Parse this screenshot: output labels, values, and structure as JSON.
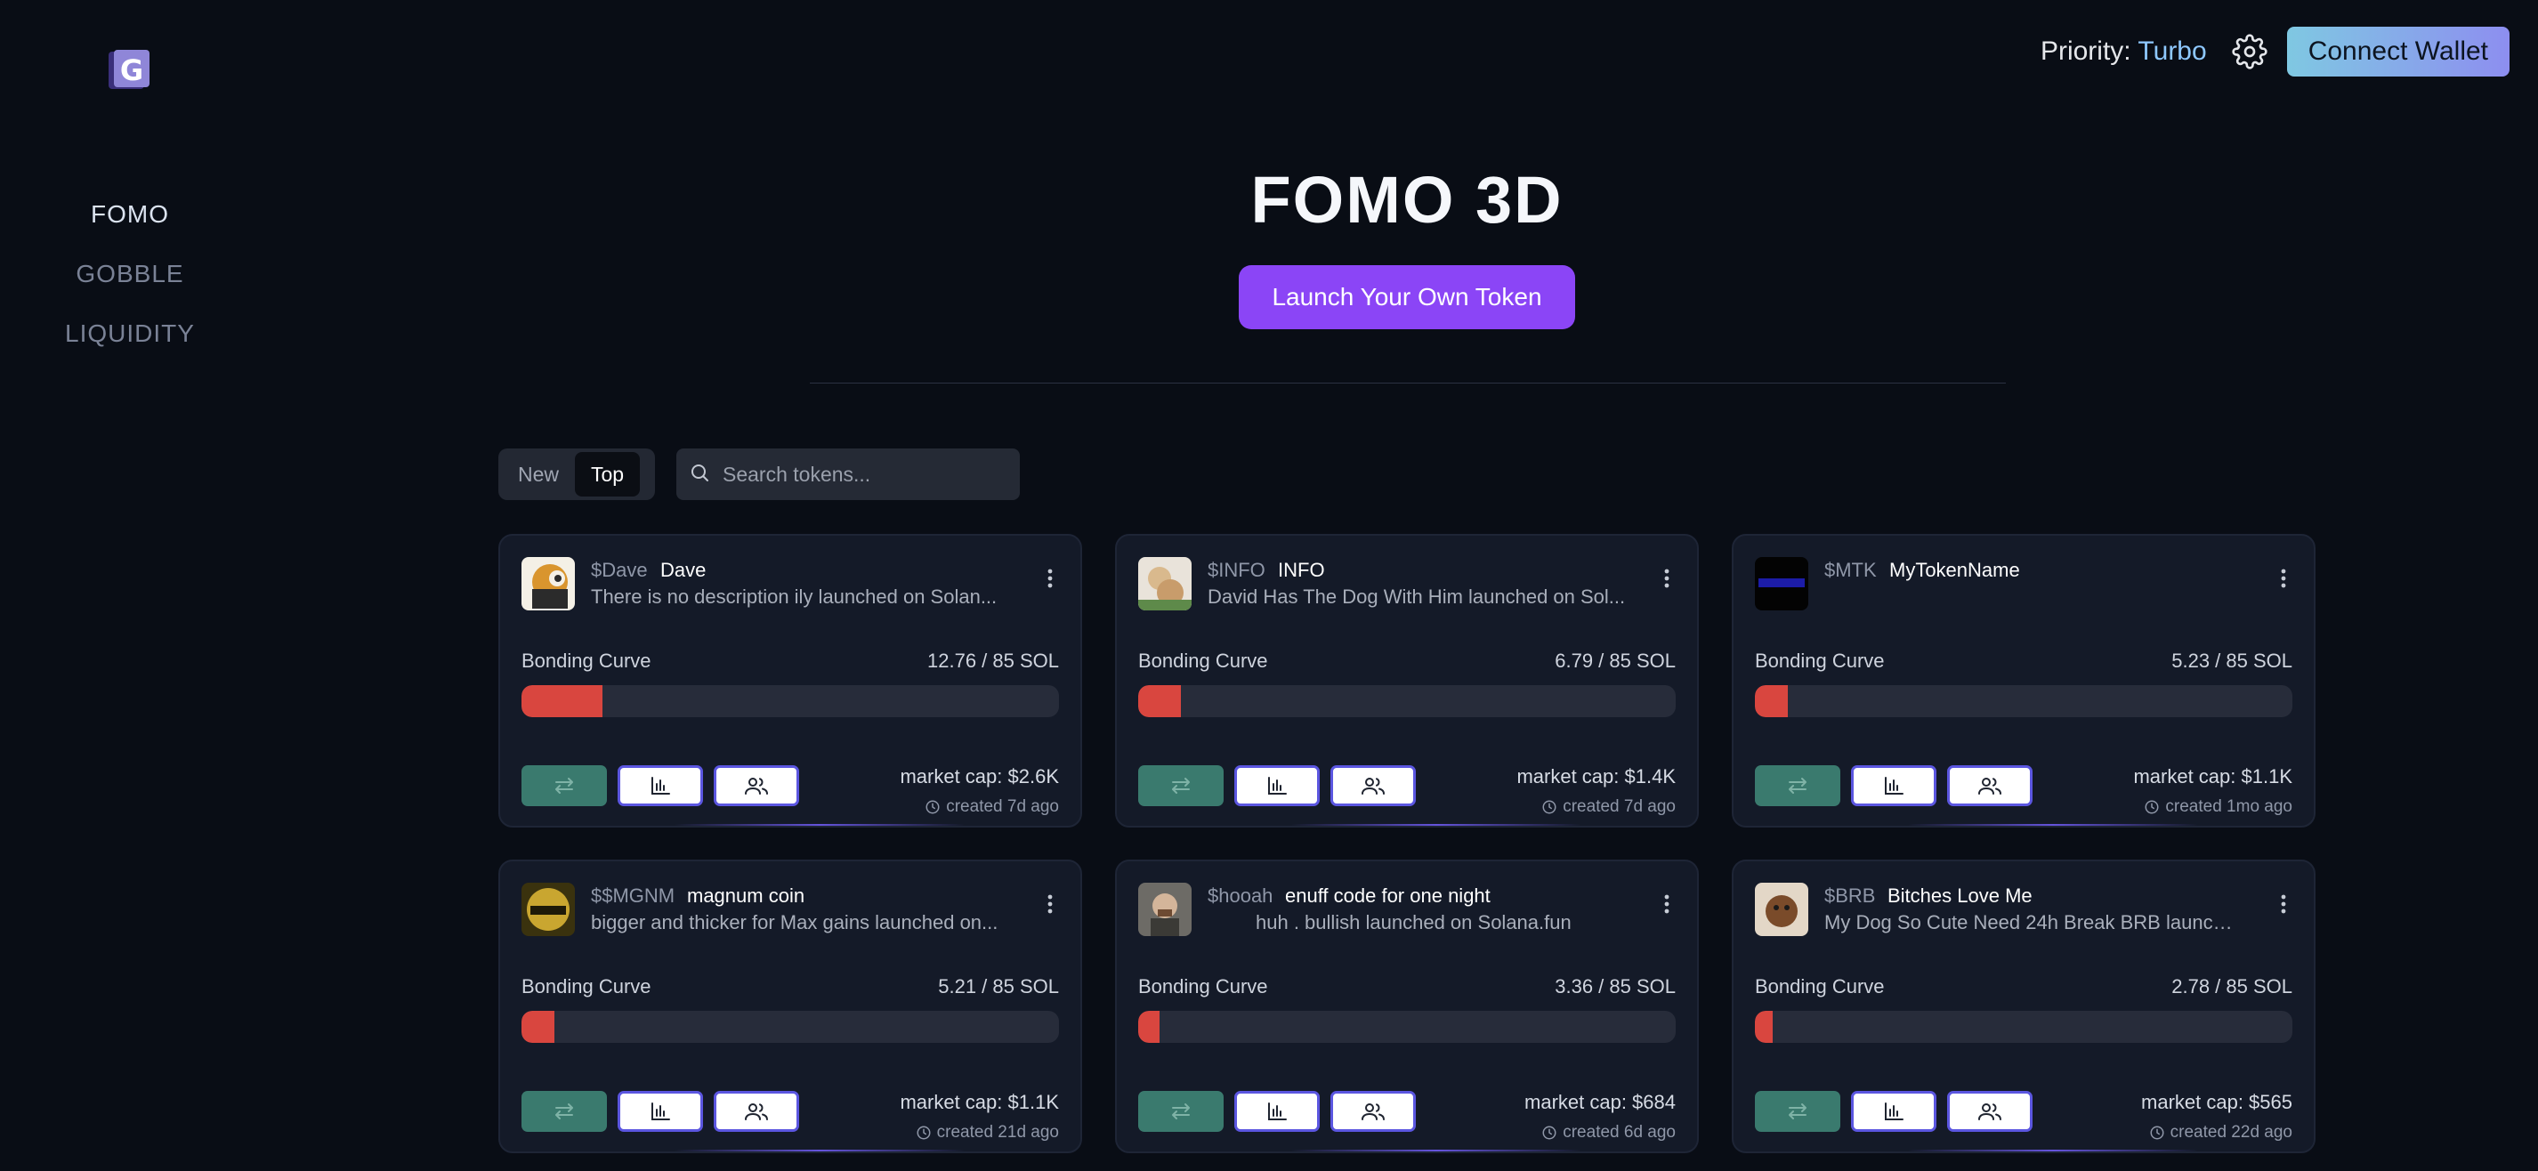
{
  "nav": {
    "items": [
      {
        "label": "FOMO",
        "active": true
      },
      {
        "label": "GOBBLE",
        "active": false
      },
      {
        "label": "LIQUIDITY",
        "active": false
      }
    ]
  },
  "topbar": {
    "priority_label": "Priority:",
    "priority_value": "Turbo",
    "connect_wallet": "Connect Wallet"
  },
  "hero": {
    "title": "FOMO 3D",
    "launch_button": "Launch Your Own Token"
  },
  "filters": {
    "new_label": "New",
    "top_label": "Top",
    "selected": "Top",
    "search_placeholder": "Search tokens..."
  },
  "colors": {
    "accent_purple": "#8b45f6",
    "progress_red": "#d9463f",
    "swap_green": "#3a7a6e",
    "background": "#090d15",
    "card": "#141a28"
  },
  "cards": [
    {
      "ticker": "$Dave",
      "name": "Dave",
      "description": "There is no description ily launched on Solan...",
      "bonding_label": "Bonding Curve",
      "bonding_value": "12.76 / 85 SOL",
      "progress": 0.15,
      "market_cap": "market cap: $2.6K",
      "created": "created 7d ago"
    },
    {
      "ticker": "$INFO",
      "name": "INFO",
      "description": "David Has The Dog With Him launched on Sol...",
      "bonding_label": "Bonding Curve",
      "bonding_value": "6.79 / 85 SOL",
      "progress": 0.08,
      "market_cap": "market cap: $1.4K",
      "created": "created 7d ago"
    },
    {
      "ticker": "$MTK",
      "name": "MyTokenName",
      "description": "",
      "bonding_label": "Bonding Curve",
      "bonding_value": "5.23 / 85 SOL",
      "progress": 0.0615,
      "market_cap": "market cap: $1.1K",
      "created": "created 1mo ago"
    },
    {
      "ticker": "$$MGNM",
      "name": "magnum coin",
      "description": "bigger and thicker for Max gains launched on...",
      "bonding_label": "Bonding Curve",
      "bonding_value": "5.21 / 85 SOL",
      "progress": 0.0613,
      "market_cap": "market cap: $1.1K",
      "created": "created 21d ago"
    },
    {
      "ticker": "$hooah",
      "name": "enuff code for one night",
      "description": "huh . bullish launched on Solana.fun",
      "bonding_label": "Bonding Curve",
      "bonding_value": "3.36 / 85 SOL",
      "progress": 0.0395,
      "market_cap": "market cap: $684",
      "created": "created 6d ago"
    },
    {
      "ticker": "$BRB",
      "name": "Bitches Love Me",
      "description": "My Dog So Cute Need 24h Break BRB launche...",
      "bonding_label": "Bonding Curve",
      "bonding_value": "2.78 / 85 SOL",
      "progress": 0.0327,
      "market_cap": "market cap: $565",
      "created": "created 22d ago"
    }
  ]
}
